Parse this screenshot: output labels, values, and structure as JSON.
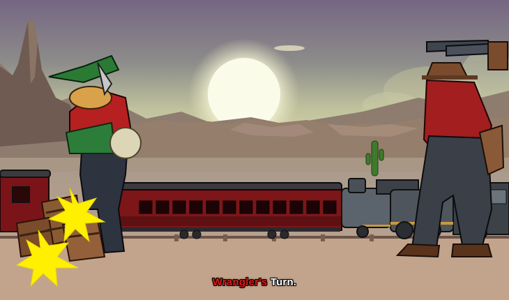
{
  "battle": {
    "active_combatant": "Wrangler's",
    "turn_suffix": " Turn."
  },
  "colors": {
    "sky_top": "#7a6a86",
    "sky_mid": "#9ea38a",
    "sky_horizon": "#d8d6a8",
    "ground": "#b9a08c",
    "train_car": "#7a1418",
    "name_highlight": "#e01818",
    "text": "#ffffff"
  },
  "icons": [
    "sun-icon",
    "cactus-icon",
    "explosion-icon",
    "barrel-icon"
  ]
}
